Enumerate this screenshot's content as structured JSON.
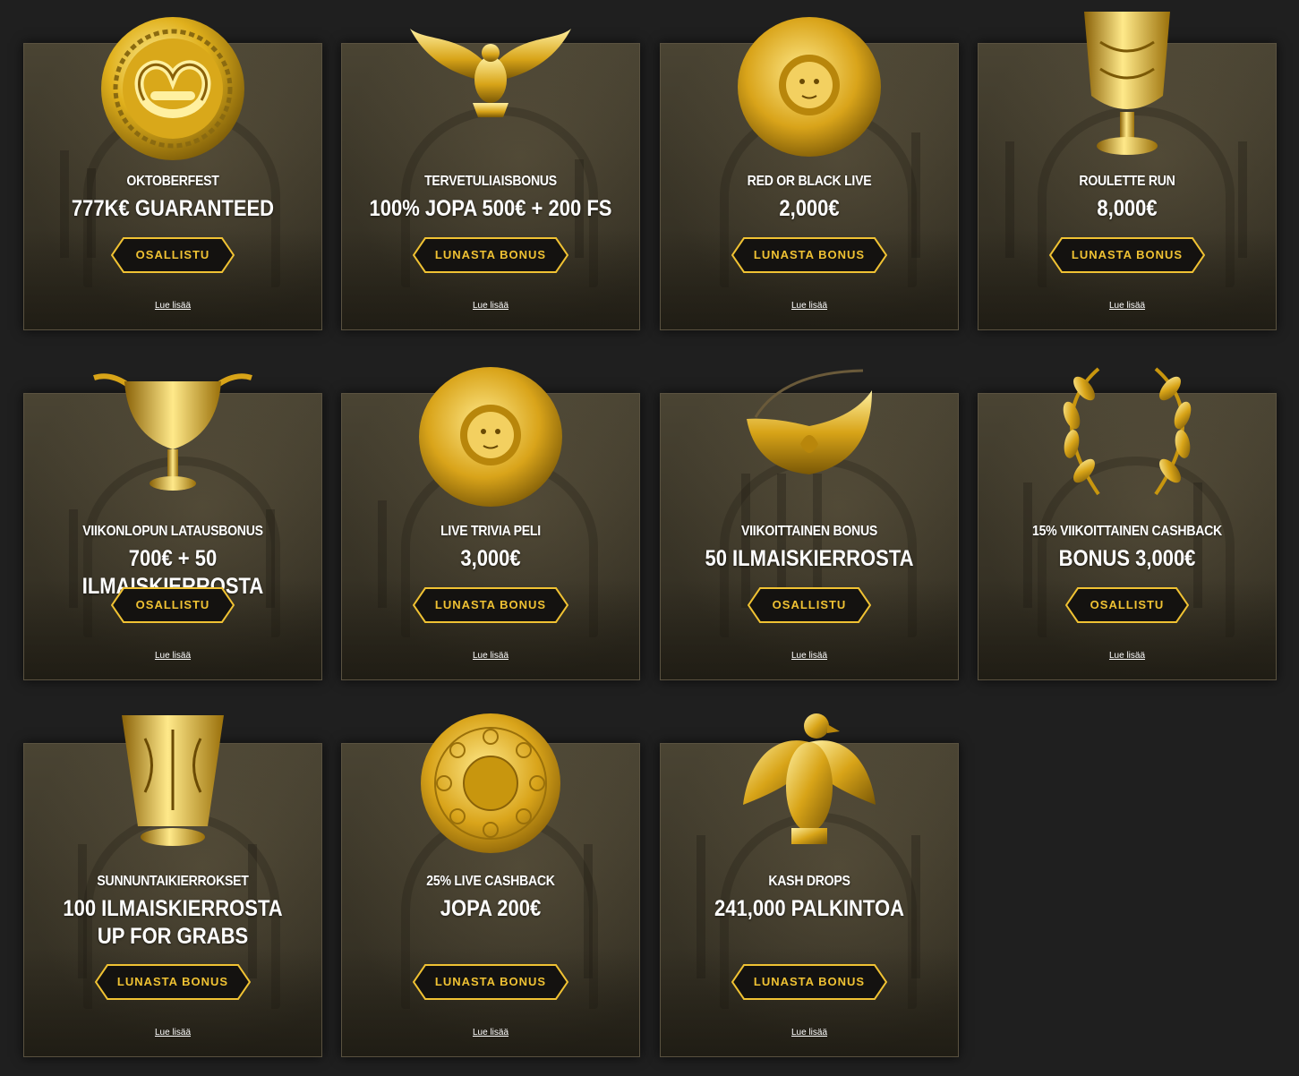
{
  "colors": {
    "page_background": "#1f1f1f",
    "accent_gold": "#f0c233",
    "button_fill": "#141210",
    "card_border": "#5a5240"
  },
  "promotions": [
    {
      "title": "OKTOBERFEST",
      "amount": "777K€ GUARANTEED",
      "button": "OSALLISTU",
      "link": "Lue lisää",
      "icon": "pretzel-medallion-icon"
    },
    {
      "title": "TERVETULIAISBONUS",
      "amount": "100% JOPA 500€ + 200 FS",
      "button": "LUNASTA BONUS",
      "link": "Lue lisää",
      "icon": "eagle-icon"
    },
    {
      "title": "RED OR BLACK LIVE",
      "amount": "2,000€",
      "button": "LUNASTA BONUS",
      "link": "Lue lisää",
      "icon": "medusa-shield-icon"
    },
    {
      "title": "ROULETTE RUN",
      "amount": "8,000€",
      "button": "LUNASTA BONUS",
      "link": "Lue lisää",
      "icon": "goblet-icon"
    },
    {
      "title": "VIIKONLOPUN LATAUSBONUS",
      "amount": "700€ + 50 ILMAISKIERROSTA",
      "button": "OSALLISTU",
      "link": "Lue lisää",
      "icon": "chalice-icon"
    },
    {
      "title": "LIVE TRIVIA PELI",
      "amount": "3,000€",
      "button": "LUNASTA BONUS",
      "link": "Lue lisää",
      "icon": "medusa-shield-icon"
    },
    {
      "title": "VIIKOITTAINEN BONUS",
      "amount": "50 ILMAISKIERROSTA",
      "button": "OSALLISTU",
      "link": "Lue lisää",
      "icon": "golden-pouch-icon"
    },
    {
      "title": "15% VIIKOITTAINEN CASHBACK",
      "amount": "BONUS 3,000€",
      "button": "OSALLISTU",
      "link": "Lue lisää",
      "icon": "laurel-wreath-icon"
    },
    {
      "title": "SUNNUNTAIKIERROKSET",
      "amount": "100 ILMAISKIERROSTA UP FOR GRABS",
      "button": "LUNASTA BONUS",
      "link": "Lue lisää",
      "icon": "ornate-cup-icon"
    },
    {
      "title": "25% LIVE CASHBACK",
      "amount": "JOPA 200€",
      "button": "LUNASTA BONUS",
      "link": "Lue lisää",
      "icon": "golden-plate-icon"
    },
    {
      "title": "KASH DROPS",
      "amount": "241,000 PALKINTOA",
      "button": "LUNASTA BONUS",
      "link": "Lue lisää",
      "icon": "standing-eagle-icon"
    }
  ]
}
